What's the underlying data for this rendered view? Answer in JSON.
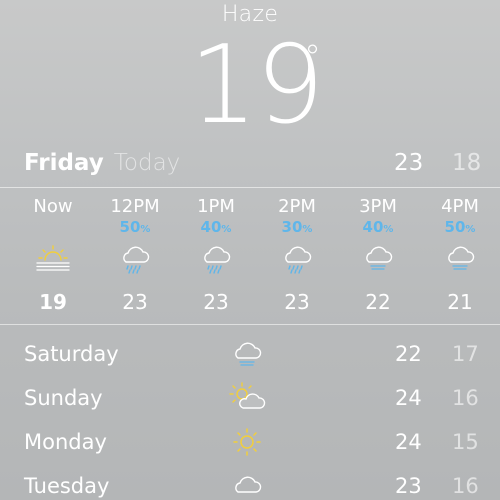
{
  "current": {
    "condition": "Haze",
    "temperature": "19",
    "degree_symbol": "°"
  },
  "today": {
    "day": "Friday",
    "label": "Today",
    "high": "23",
    "low": "18"
  },
  "hourly": [
    {
      "time": "Now",
      "precip": "",
      "precip_unit": "",
      "icon": "haze-sun-icon",
      "temp": "19"
    },
    {
      "time": "12PM",
      "precip": "50",
      "precip_unit": "%",
      "icon": "cloud-rain-icon",
      "temp": "23"
    },
    {
      "time": "1PM",
      "precip": "40",
      "precip_unit": "%",
      "icon": "cloud-rain-icon",
      "temp": "23"
    },
    {
      "time": "2PM",
      "precip": "30",
      "precip_unit": "%",
      "icon": "cloud-rain-icon",
      "temp": "23"
    },
    {
      "time": "3PM",
      "precip": "40",
      "precip_unit": "%",
      "icon": "cloud-drizzle-icon",
      "temp": "22"
    },
    {
      "time": "4PM",
      "precip": "50",
      "precip_unit": "%",
      "icon": "cloud-drizzle-icon",
      "temp": "21"
    }
  ],
  "daily": [
    {
      "day": "Saturday",
      "icon": "cloud-drizzle-icon",
      "high": "22",
      "low": "17"
    },
    {
      "day": "Sunday",
      "icon": "partly-cloudy-icon",
      "high": "24",
      "low": "16"
    },
    {
      "day": "Monday",
      "icon": "sun-icon",
      "high": "24",
      "low": "15"
    },
    {
      "day": "Tuesday",
      "icon": "cloud-icon",
      "high": "23",
      "low": "16"
    }
  ],
  "colors": {
    "precip": "#5fb6ea",
    "sun": "#f2cf3b",
    "text": "#ffffff"
  }
}
